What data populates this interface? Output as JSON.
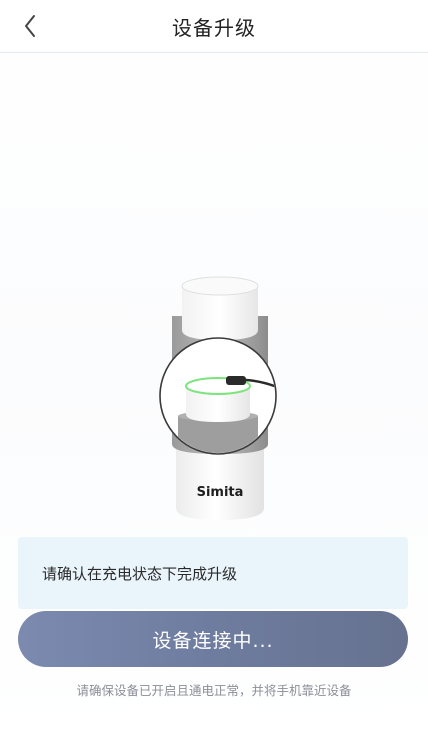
{
  "header": {
    "back_icon": "chevron-left-icon",
    "title": "设备升级"
  },
  "device": {
    "brand_label": "Simita",
    "charging_indicator_color": "#7de47d"
  },
  "notice": {
    "text": "请确认在充电状态下完成升级"
  },
  "action": {
    "button_label": "设备连接中..."
  },
  "footer": {
    "hint": "请确保设备已开启且通电正常，并将手机靠近设备"
  },
  "colors": {
    "button_gradient_start": "#7c8ab0",
    "button_gradient_end": "#66728f",
    "notice_background": "#eaf4fb"
  }
}
